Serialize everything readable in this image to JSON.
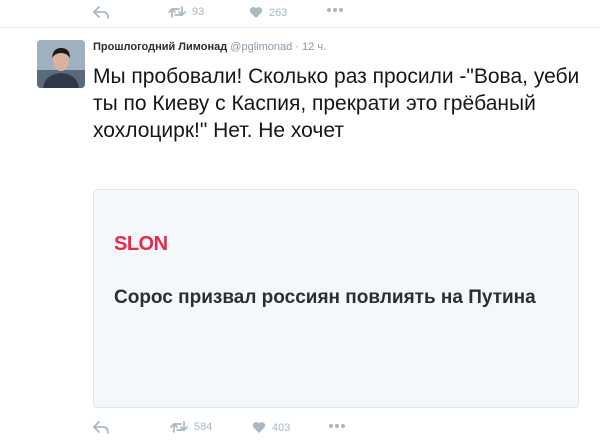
{
  "prev_tweet": {
    "actions": {
      "retweets": "93",
      "likes": "263"
    }
  },
  "tweet": {
    "author_name": "Прошлогодний Лимонад",
    "handle": "@pglimonad",
    "separator": "·",
    "time": "12 ч.",
    "text": "Мы пробовали! Сколько раз просили -\"Вова, уеби ты по Киеву с Каспия, прекрати это грёбаный хохлоцирк!\" Нет. Не хочет",
    "card": {
      "source_logo": "SLON",
      "title": "Сорос призвал россиян повлиять на Путина"
    },
    "actions": {
      "retweets": "584",
      "likes": "403"
    }
  },
  "colors": {
    "icon": "#aab8c2",
    "source_logo": "#e8294a",
    "card_bg": "#f5f8fa",
    "border": "#e1e8ed"
  },
  "icons": [
    "reply-icon",
    "retweet-icon",
    "like-icon",
    "more-icon"
  ]
}
